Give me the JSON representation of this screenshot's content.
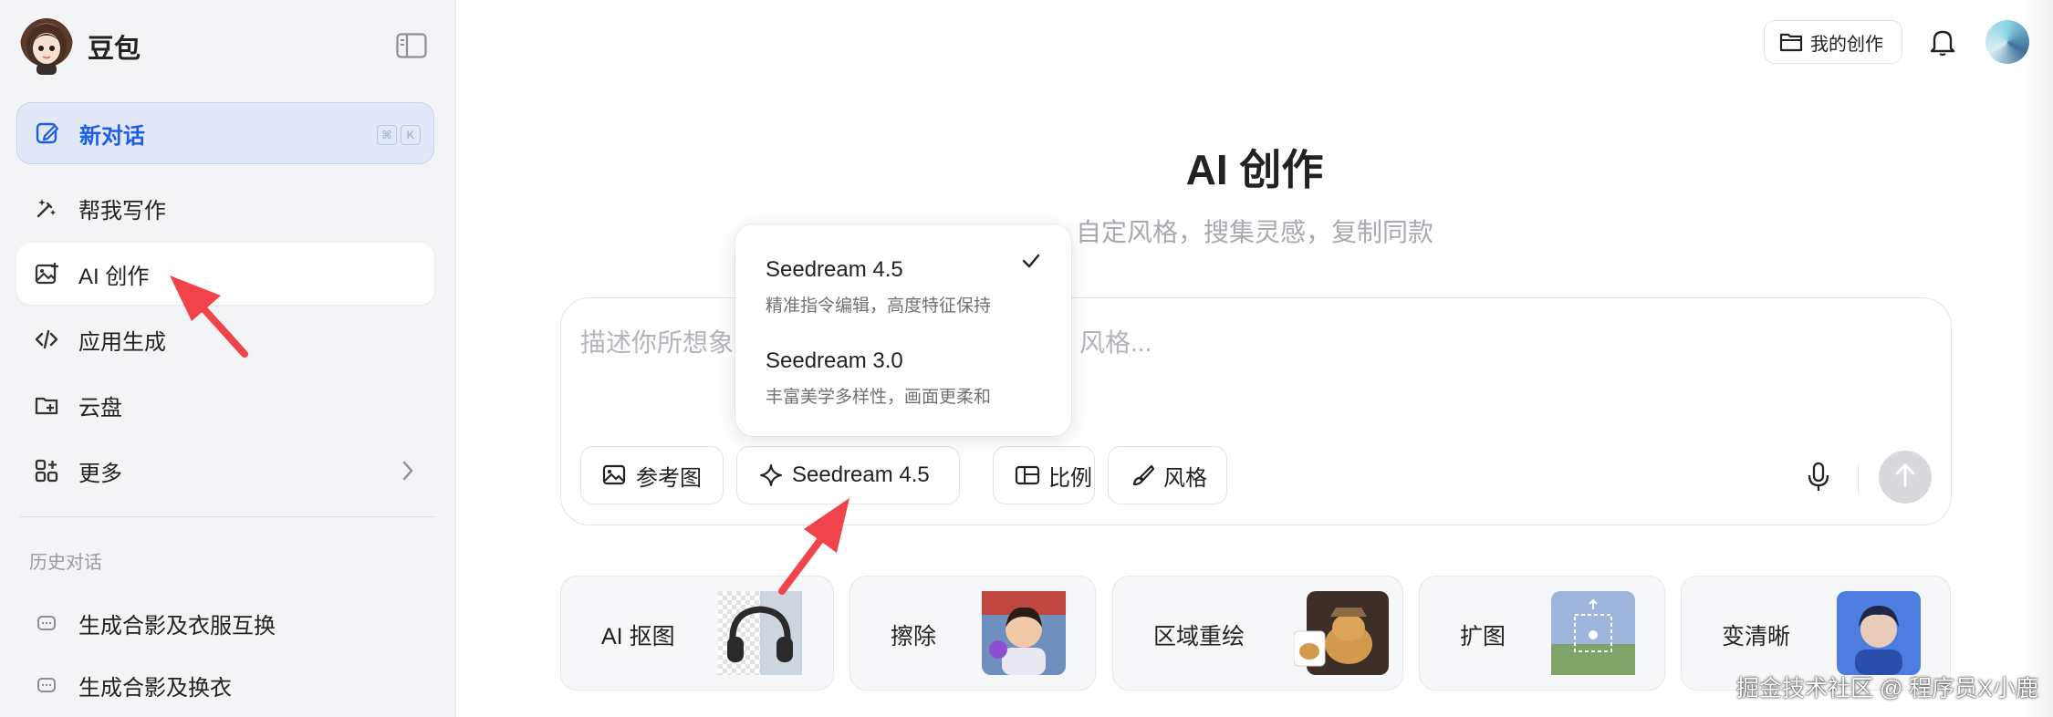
{
  "sidebar": {
    "brand_name": "豆包",
    "new_chat": {
      "label": "新对话",
      "shortcut": [
        "⌘",
        "K"
      ]
    },
    "items": [
      {
        "label": "帮我写作",
        "icon": "pen-sparkle-icon"
      },
      {
        "label": "AI 创作",
        "icon": "image-plus-icon",
        "active": true
      },
      {
        "label": "应用生成",
        "icon": "code-icon"
      },
      {
        "label": "云盘",
        "icon": "cloud-folder-icon"
      },
      {
        "label": "更多",
        "icon": "grid-plus-icon"
      }
    ],
    "history_title": "历史对话",
    "history": [
      {
        "label": "生成合影及衣服互换"
      },
      {
        "label": "生成合影及换衣"
      }
    ]
  },
  "header": {
    "my_creations": "我的创作"
  },
  "main": {
    "title": "AI 创作",
    "subtitle": "自定风格，搜集灵感，复制同款",
    "prompt_placeholder_left": "描述你所想象",
    "prompt_placeholder_right": "风格...",
    "tools": [
      {
        "label": "参考图",
        "icon": "image-upload-icon"
      },
      {
        "label": "Seedream 4.5",
        "icon": "sparkle-icon"
      },
      {
        "label": "比例",
        "icon": "aspect-ratio-icon"
      },
      {
        "label": "风格",
        "icon": "brush-icon"
      }
    ]
  },
  "model_dropdown": {
    "options": [
      {
        "name": "Seedream 4.5",
        "desc": "精准指令编辑，高度特征保持",
        "selected": true
      },
      {
        "name": "Seedream 3.0",
        "desc": "丰富美学多样性，画面更柔和",
        "selected": false
      }
    ]
  },
  "cards": [
    {
      "label": "AI 抠图"
    },
    {
      "label": "擦除"
    },
    {
      "label": "区域重绘"
    },
    {
      "label": "扩图"
    },
    {
      "label": "变清晰"
    }
  ],
  "watermark": "掘金技术社区 @ 程序员X小鹿",
  "colors": {
    "accent": "#1d5ee8",
    "annotation_arrow": "#f0444a",
    "sidebar_bg": "#f3f4f6"
  }
}
